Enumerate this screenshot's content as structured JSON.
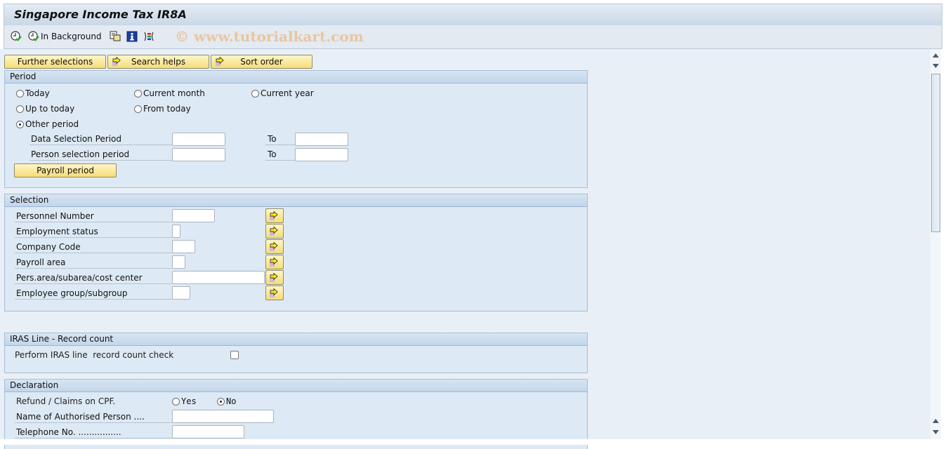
{
  "window": {
    "title": "Singapore Income Tax IR8A"
  },
  "toolbar": {
    "items": [
      {
        "name": "execute",
        "icon": "execute-clock-icon",
        "label": ""
      },
      {
        "name": "execute-background",
        "icon": "execute-clock-icon",
        "label": "In Background"
      },
      {
        "name": "get-variant",
        "icon": "variant-icon",
        "label": ""
      },
      {
        "name": "information",
        "icon": "info-icon",
        "label": ""
      },
      {
        "name": "selection-options",
        "icon": "selection-options-icon",
        "label": ""
      }
    ],
    "watermark": "© www.tutorialkart.com"
  },
  "buttons": {
    "further_selections": "Further selections",
    "search_helps": "Search helps",
    "sort_order": "Sort order"
  },
  "period": {
    "title": "Period",
    "options": [
      {
        "label": "Today",
        "selected": false
      },
      {
        "label": "Current month",
        "selected": false
      },
      {
        "label": "Current year",
        "selected": false
      },
      {
        "label": "Up to today",
        "selected": false
      },
      {
        "label": "From today",
        "selected": false
      },
      {
        "label": "Other period",
        "selected": true
      }
    ],
    "data_selection_label": "Data Selection Period",
    "data_selection_from": "",
    "data_selection_to": "",
    "person_selection_label": "Person selection period",
    "person_selection_from": "",
    "person_selection_to": "",
    "to_label": "To",
    "payroll_period_button": "Payroll period"
  },
  "selection": {
    "title": "Selection",
    "fields": [
      {
        "label": "Personnel Number",
        "value": ""
      },
      {
        "label": "Employment status",
        "value": ""
      },
      {
        "label": "Company Code",
        "value": ""
      },
      {
        "label": "Payroll area",
        "value": ""
      },
      {
        "label": "Pers.area/subarea/cost center",
        "value": ""
      },
      {
        "label": "Employee group/subgroup",
        "value": ""
      }
    ]
  },
  "iras": {
    "title": "IRAS Line - Record count",
    "check_label": "Perform IRAS line  record count check",
    "checked": false
  },
  "declaration": {
    "title": "Declaration",
    "refund_label": "Refund / Claims on CPF.",
    "yes_label": "Yes",
    "no_label": "No",
    "refund_value": "No",
    "authorised_person_label": "Name of Authorised Person ....",
    "authorised_person_value": "",
    "telephone_label": "Telephone No. ................",
    "telephone_value": ""
  }
}
